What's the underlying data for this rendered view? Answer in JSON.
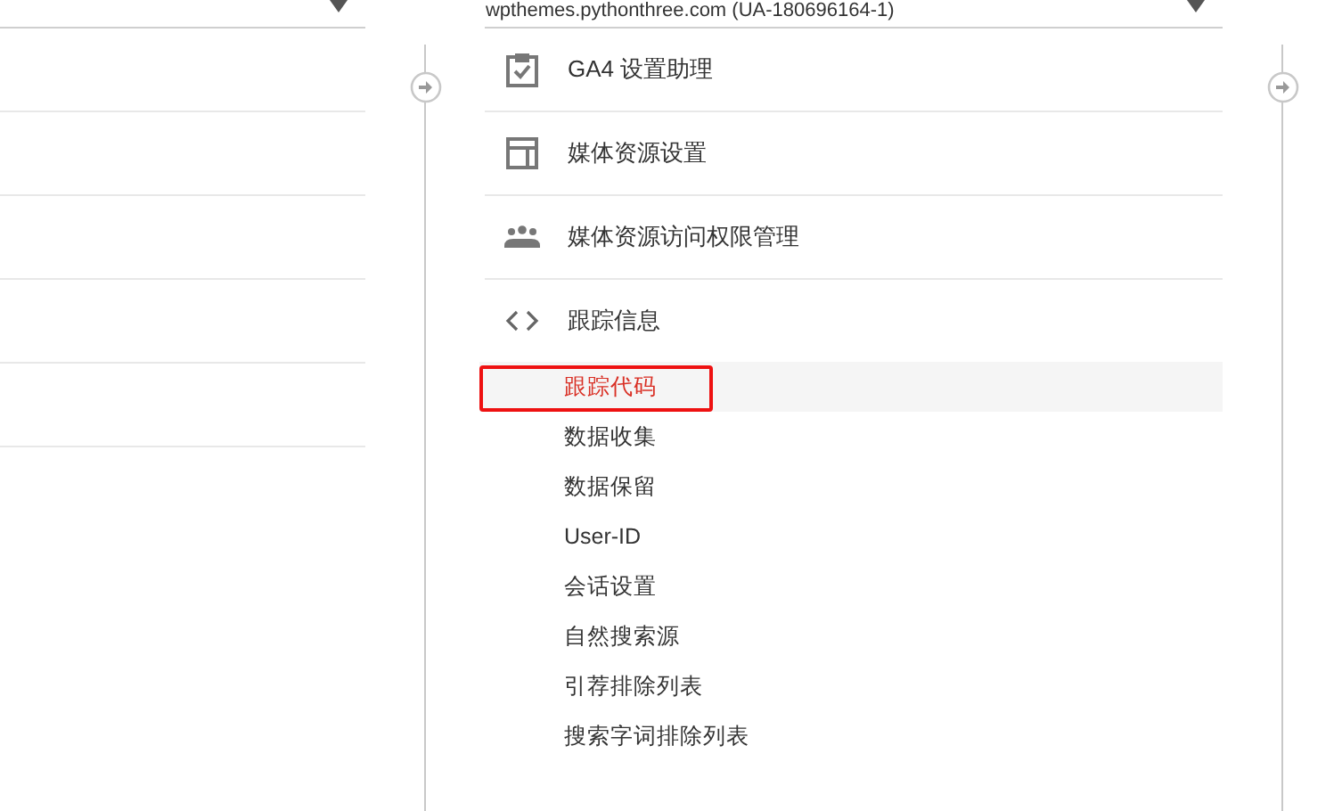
{
  "property_selector": {
    "value": "wpthemes.pythonthree.com (UA-180696164-1)"
  },
  "menu": [
    {
      "kind": "assistant",
      "label": "GA4 设置助理"
    },
    {
      "kind": "settings",
      "label": "媒体资源设置"
    },
    {
      "kind": "users",
      "label": "媒体资源访问权限管理"
    },
    {
      "kind": "code",
      "label": "跟踪信息",
      "children": [
        {
          "label": "跟踪代码",
          "selected": true
        },
        {
          "label": "数据收集",
          "selected": false
        },
        {
          "label": "数据保留",
          "selected": false
        },
        {
          "label": "User-ID",
          "selected": false
        },
        {
          "label": "会话设置",
          "selected": false
        },
        {
          "label": "自然搜索源",
          "selected": false
        },
        {
          "label": "引荐排除列表",
          "selected": false
        },
        {
          "label": "搜索字词排除列表",
          "selected": false
        }
      ]
    }
  ]
}
